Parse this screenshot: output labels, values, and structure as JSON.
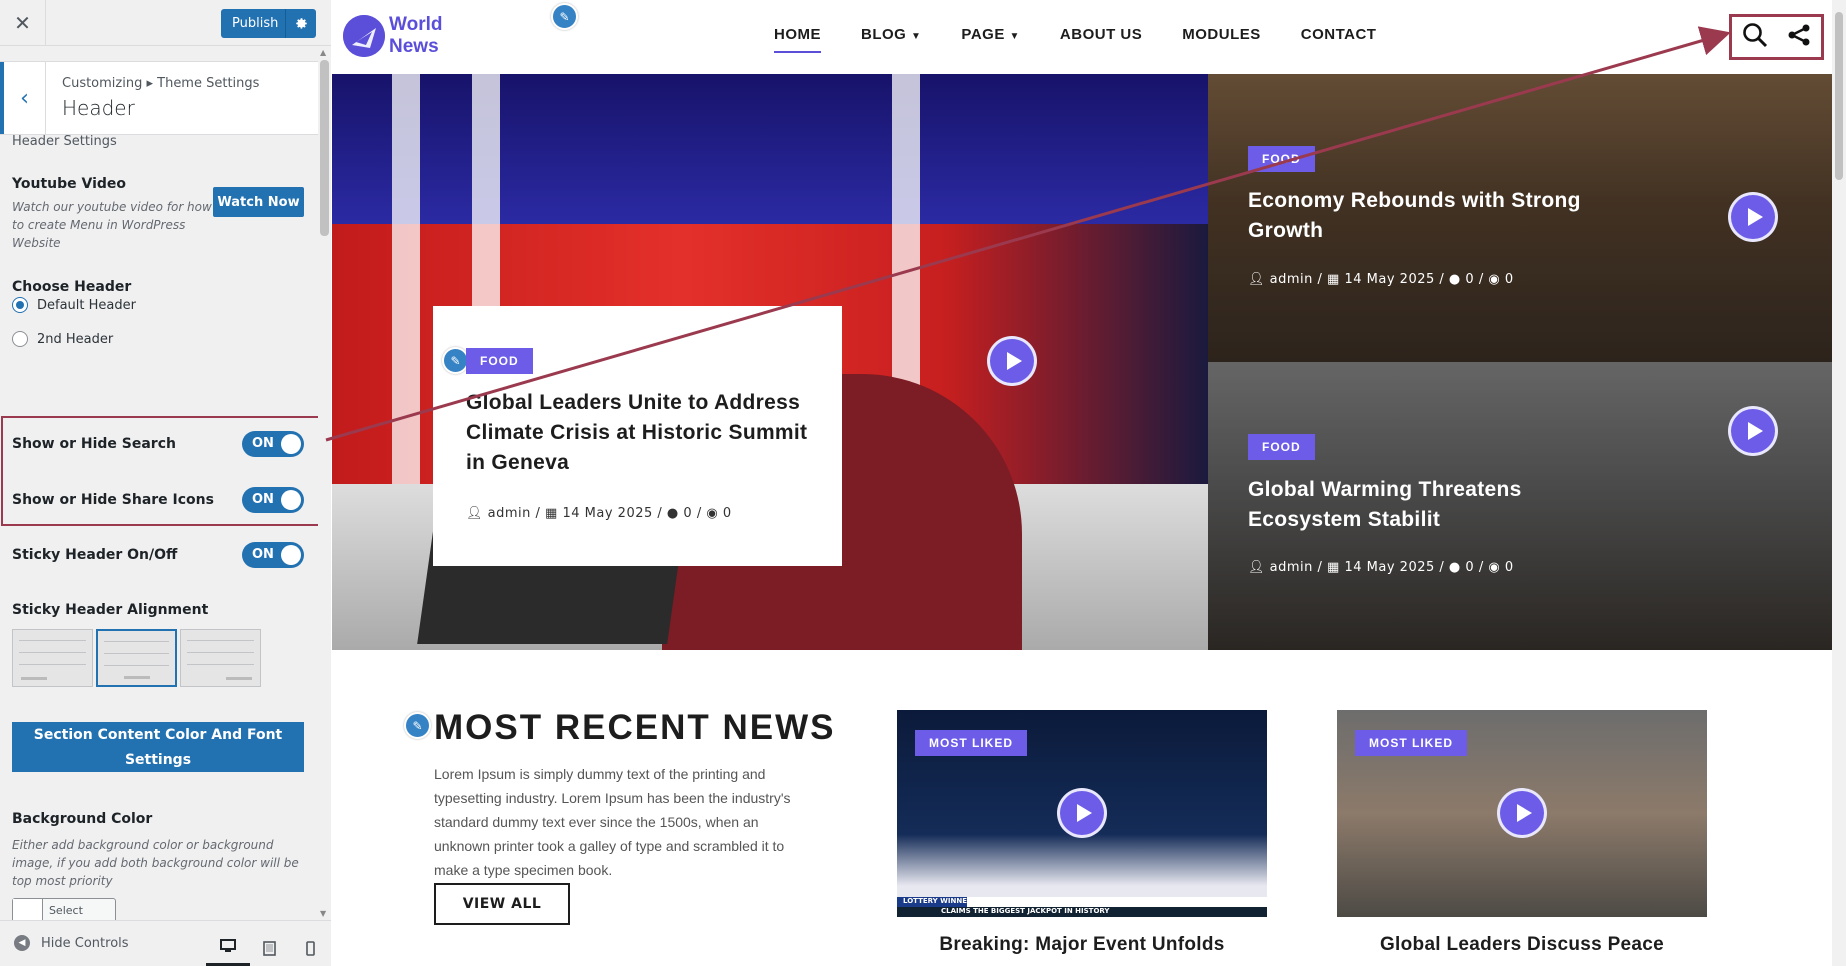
{
  "sidebar": {
    "close_icon": "close-icon",
    "publish_label": "Publish",
    "breadcrumb": "Customizing ▸ Theme Settings",
    "panel_title": "Header",
    "section_title": "Header Settings",
    "youtube": {
      "label": "Youtube Video",
      "description": "Watch our youtube video for how to create Menu in WordPress Website",
      "button": "Watch Now"
    },
    "choose_header": {
      "label": "Choose Header",
      "options": [
        "Default Header",
        "2nd Header"
      ],
      "selected": "Default Header"
    },
    "toggles": [
      {
        "label": "Show or Hide Search",
        "state": "ON"
      },
      {
        "label": "Show or Hide Share Icons",
        "state": "ON"
      },
      {
        "label": "Sticky Header On/Off",
        "state": "ON"
      }
    ],
    "sticky_alignment_label": "Sticky Header Alignment",
    "section_button": "Section Content Color And Font Settings",
    "background": {
      "label": "Background Color",
      "description": "Either add background color or background image, if you add both background color will be top most priority",
      "select_color": "Select Color"
    },
    "footer": {
      "hide_controls": "Hide Controls"
    },
    "accent_color": "#2271b1",
    "highlight_color": "#9b3a4e"
  },
  "site": {
    "logo_line1": "World",
    "logo_line2": "News",
    "menu": [
      "HOME",
      "BLOG",
      "PAGE",
      "ABOUT US",
      "MODULES",
      "CONTACT"
    ],
    "menu_dropdowns": [
      "BLOG",
      "PAGE"
    ],
    "active_menu": "HOME",
    "brand_color": "#5b4fd9",
    "hero_main": {
      "badge": "FOOD",
      "title": "Global Leaders Unite to Address Climate Crisis at Historic Summit in Geneva",
      "author": "admin",
      "date": "14 May 2025",
      "comments": "0",
      "views": "0"
    },
    "hero_side": [
      {
        "badge": "FOOD",
        "title": "Economy Rebounds with Strong Growth",
        "author": "admin",
        "date": "14 May 2025",
        "comments": "0",
        "views": "0"
      },
      {
        "badge": "FOOD",
        "title": "Global Warming Threatens Ecosystem Stabilit",
        "author": "admin",
        "date": "14 May 2025",
        "comments": "0",
        "views": "0"
      }
    ],
    "recent": {
      "title": "MOST RECENT NEWS",
      "text": "Lorem Ipsum is simply dummy text of the printing and typesetting industry. Lorem Ipsum has been the industry's standard dummy text ever since the 1500s, when an unknown printer took a galley of type and scrambled it to make a type specimen book.",
      "button": "VIEW ALL"
    },
    "news_cards": [
      {
        "badge": "MOST LIKED",
        "title": "Breaking: Major Event Unfolds",
        "ticker_top": "LOTTERY WINNER",
        "ticker_bottom": "CLAIMS THE BIGGEST JACKPOT IN HISTORY"
      },
      {
        "badge": "MOST LIKED",
        "title": "Global Leaders Discuss Peace"
      }
    ]
  }
}
